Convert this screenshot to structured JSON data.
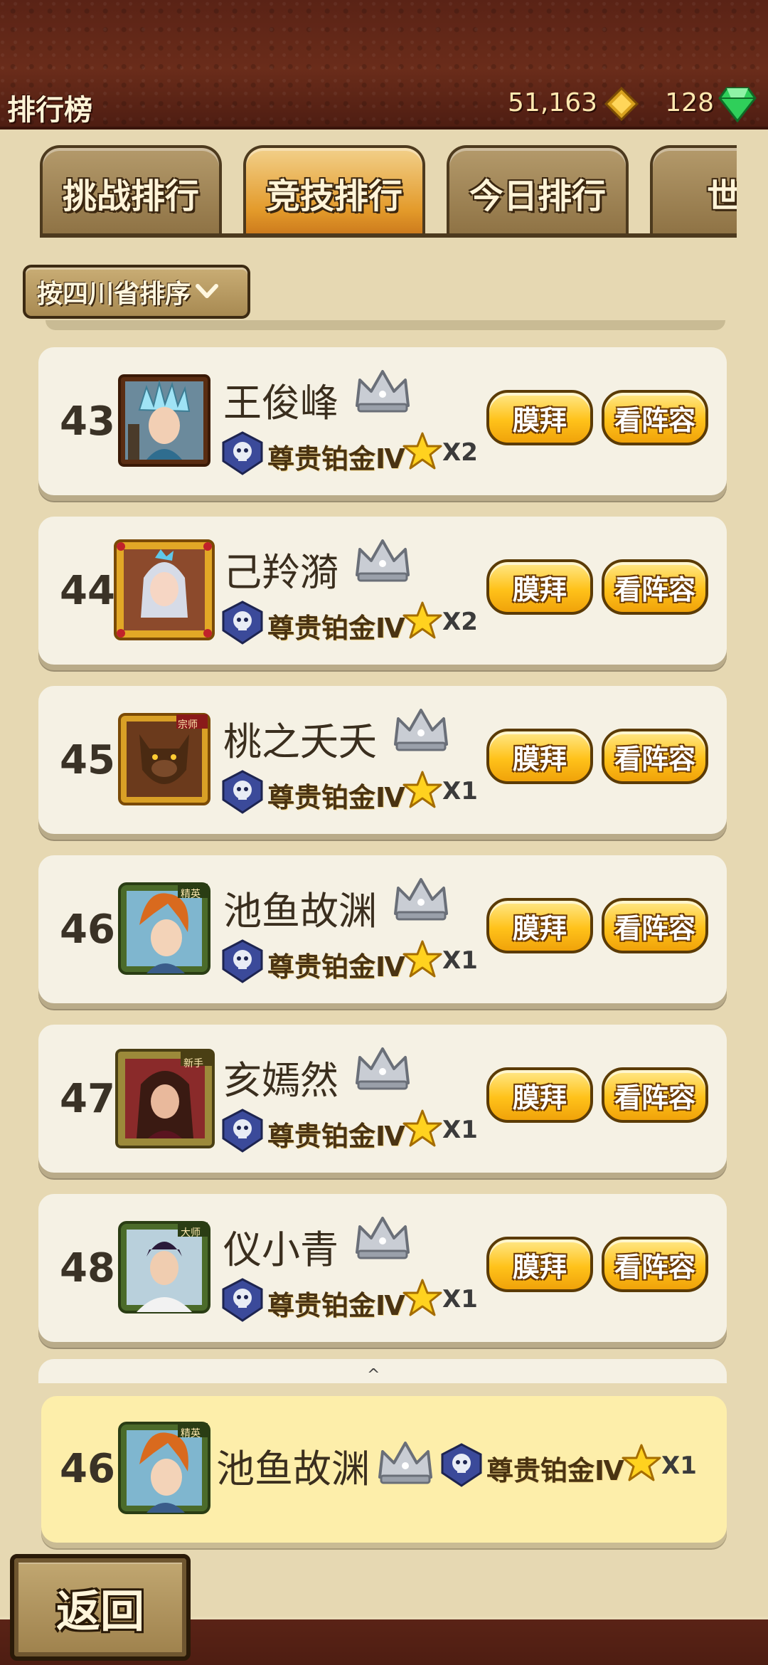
{
  "header": {
    "title": "排行榜",
    "gold": "51,163",
    "gems": "128",
    "gold_icon": "gold-ingot-icon",
    "gem_icon": "green-gem-icon"
  },
  "tabs": [
    {
      "label": "挑战排行",
      "active": false
    },
    {
      "label": "竞技排行",
      "active": true
    },
    {
      "label": "今日排行",
      "active": false
    },
    {
      "label": "世界",
      "active": false
    }
  ],
  "sort": {
    "label": "按四川省排序",
    "icon": "chevron-down-icon"
  },
  "buttons": {
    "worship": "膜拜",
    "lineup": "看阵容"
  },
  "rows": [
    {
      "rank": "43",
      "name": "王俊峰",
      "tier": "尊贵铂金Ⅳ",
      "mult": "X2",
      "frame": "plain",
      "tag": ""
    },
    {
      "rank": "44",
      "name": "己羚漪",
      "tier": "尊贵铂金Ⅳ",
      "mult": "X2",
      "frame": "gold",
      "tag": ""
    },
    {
      "rank": "45",
      "name": "桃之夭夭",
      "tier": "尊贵铂金Ⅳ",
      "mult": "X1",
      "frame": "gold",
      "tag": "宗师"
    },
    {
      "rank": "46",
      "name": "池鱼故渊",
      "tier": "尊贵铂金Ⅳ",
      "mult": "X1",
      "frame": "vine",
      "tag": "精英"
    },
    {
      "rank": "47",
      "name": "亥嫣然",
      "tier": "尊贵铂金Ⅳ",
      "mult": "X1",
      "frame": "bamboo",
      "tag": "新手"
    },
    {
      "rank": "48",
      "name": "仪小青",
      "tier": "尊贵铂金Ⅳ",
      "mult": "X1",
      "frame": "vine",
      "tag": "大师"
    }
  ],
  "self": {
    "rank": "46",
    "name": "池鱼故渊",
    "tier": "尊贵铂金Ⅳ",
    "mult": "X1",
    "tag": "精英"
  },
  "back_label": "返回",
  "colors": {
    "accent": "#f0a30a",
    "leather": "#5a2316",
    "panel": "#e6d8b2"
  }
}
